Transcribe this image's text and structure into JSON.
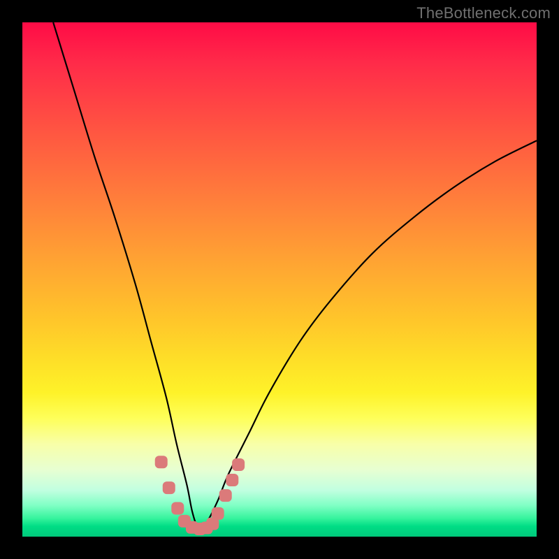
{
  "watermark": "TheBottleneck.com",
  "colors": {
    "curve_stroke": "#000000",
    "marker_fill": "#db7a7a",
    "marker_stroke": "#c15e5e",
    "frame_border": "#000000"
  },
  "chart_data": {
    "type": "line",
    "title": "",
    "xlabel": "",
    "ylabel": "",
    "xlim": [
      0,
      100
    ],
    "ylim": [
      0,
      100
    ],
    "grid": false,
    "series": [
      {
        "name": "bottleneck-curve",
        "comment": "V-shaped curve; values are approximate readings from the plot (0 = bottom/green, 100 = top/red). Minimum near x≈34.",
        "x": [
          6,
          10,
          14,
          18,
          22,
          25,
          28,
          30,
          32,
          33,
          34,
          35,
          36,
          38,
          40,
          44,
          48,
          54,
          60,
          68,
          76,
          84,
          92,
          100
        ],
        "y": [
          100,
          87,
          74,
          62,
          49,
          38,
          27,
          18,
          10,
          5,
          2,
          2,
          3,
          7,
          12,
          20,
          28,
          38,
          46,
          55,
          62,
          68,
          73,
          77
        ]
      },
      {
        "name": "sample-markers",
        "comment": "Salmon-colored sample points clustered near the trough of the curve.",
        "x": [
          27.0,
          28.5,
          30.2,
          31.5,
          33.0,
          34.5,
          35.8,
          37.0,
          38.0,
          39.5,
          40.8,
          42.0
        ],
        "y": [
          14.5,
          9.5,
          5.5,
          3.0,
          1.8,
          1.5,
          1.7,
          2.5,
          4.5,
          8.0,
          11.0,
          14.0
        ]
      }
    ]
  }
}
